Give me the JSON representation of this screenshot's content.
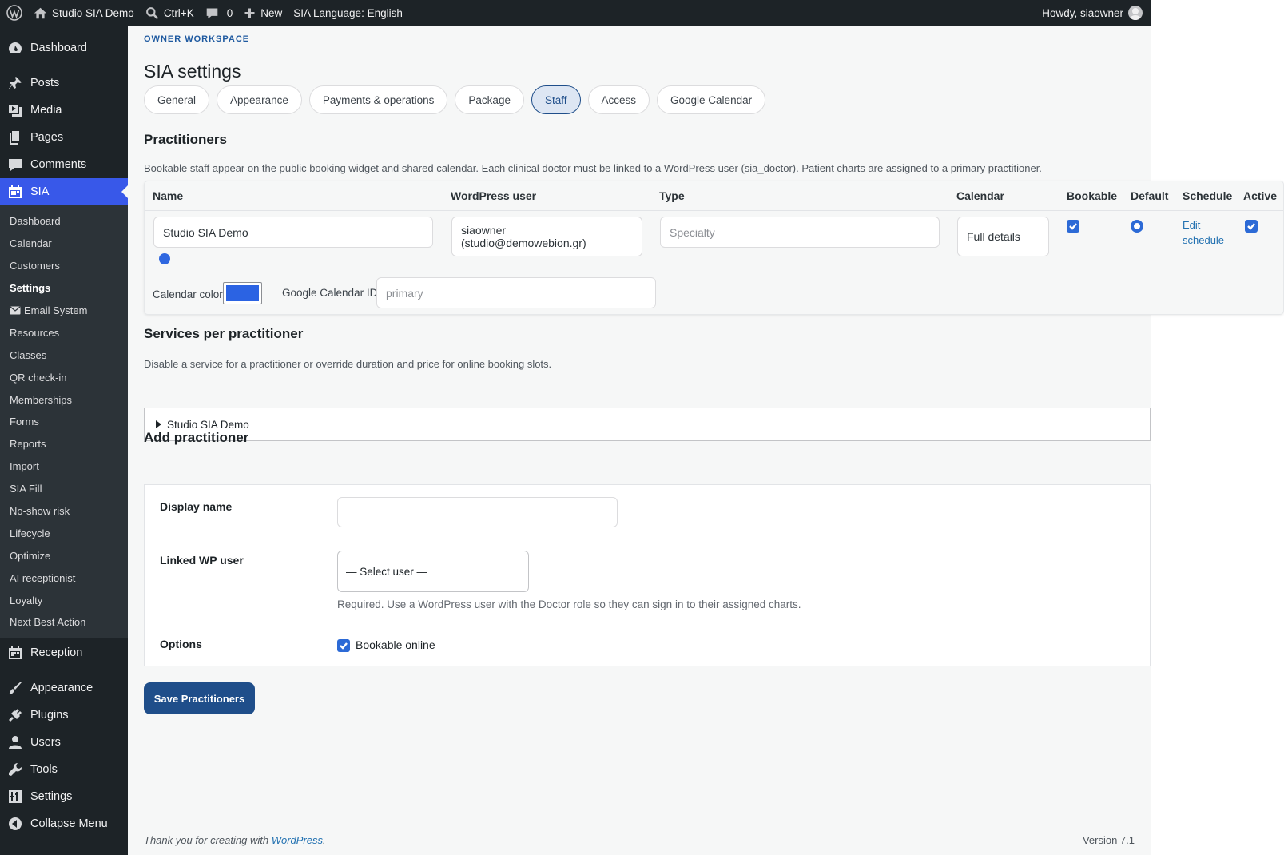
{
  "adminbar": {
    "site_name": "Studio SIA Demo",
    "search_shortcut": "Ctrl+K",
    "comments_count": "0",
    "new_label": "New",
    "language": "SIA Language: English",
    "howdy": "Howdy, siaowner"
  },
  "sidebar": {
    "dashboard": "Dashboard",
    "posts": "Posts",
    "media": "Media",
    "pages": "Pages",
    "comments": "Comments",
    "sia": "SIA",
    "submenu": [
      "Dashboard",
      "Calendar",
      "Customers",
      "Settings",
      "Email System",
      "Resources",
      "Classes",
      "QR check-in",
      "Memberships",
      "Forms",
      "Reports",
      "Import",
      "SIA Fill",
      "No-show risk",
      "Lifecycle",
      "Optimize",
      "AI receptionist",
      "Loyalty",
      "Next Best Action"
    ],
    "reception": "Reception",
    "appearance": "Appearance",
    "plugins": "Plugins",
    "users": "Users",
    "tools": "Tools",
    "settings": "Settings",
    "collapse": "Collapse Menu"
  },
  "page": {
    "eyebrow": "OWNER WORKSPACE",
    "title": "SIA settings",
    "tabs": [
      "General",
      "Appearance",
      "Payments & operations",
      "Package",
      "Staff",
      "Access",
      "Google Calendar"
    ],
    "active_tab": "Staff"
  },
  "practitioners": {
    "heading": "Practitioners",
    "description": "Bookable staff appear on the public booking widget and shared calendar. Each clinical doctor must be linked to a WordPress user (sia_doctor). Patient charts are assigned to a primary practitioner.",
    "columns": [
      "Name",
      "WordPress user",
      "Type",
      "Calendar",
      "Bookable",
      "Default",
      "Schedule",
      "Active"
    ],
    "row": {
      "name": "Studio SIA Demo",
      "wp_user": "siaowner (studio@demowebion.gr)",
      "type_placeholder": "Specialty",
      "calendar": "Full details",
      "bookable": true,
      "default": true,
      "schedule_link": "Edit schedule",
      "active": true,
      "calendar_color_label": "Calendar color",
      "calendar_color": "#2b63e3",
      "gcal_label": "Google Calendar ID",
      "gcal_placeholder": "primary"
    }
  },
  "services": {
    "heading": "Services per practitioner",
    "description": "Disable a service for a practitioner or override duration and price for online booking slots.",
    "item": "Studio SIA Demo"
  },
  "add": {
    "heading": "Add practitioner",
    "display_name_label": "Display name",
    "display_name_value": "",
    "linked_user_label": "Linked WP user",
    "linked_user_select": "— Select user —",
    "linked_user_help": "Required. Use a WordPress user with the Doctor role so they can sign in to their assigned charts.",
    "options_label": "Options",
    "bookable_online": "Bookable online"
  },
  "save_button": "Save Practitioners",
  "footer": {
    "thanks_prefix": "Thank you for creating with ",
    "wordpress_link": "WordPress",
    "thanks_suffix": ".",
    "version": "Version 7.1"
  },
  "colors": {
    "sidebar_bg": "#1d2327",
    "current_menu": "#3858e9",
    "primary_button": "#1f4e8a",
    "checkbox": "#2c6ad6"
  }
}
